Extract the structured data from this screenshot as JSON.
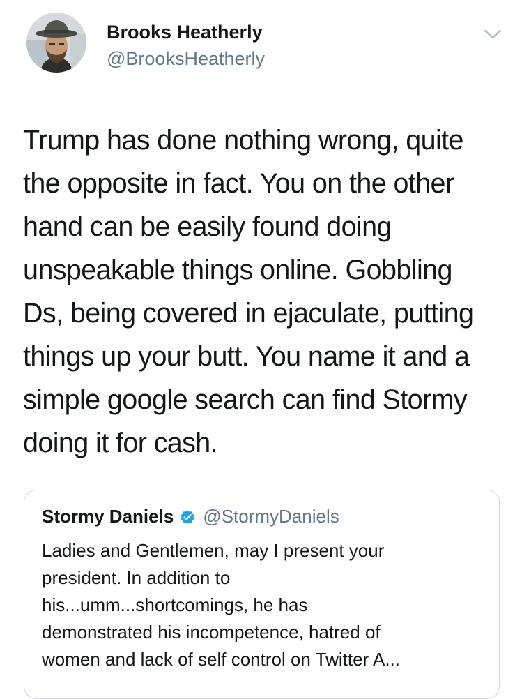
{
  "tweet": {
    "author": {
      "name": "Brooks Heatherly",
      "handle": "@BrooksHeatherly"
    },
    "text": "Trump has done nothing wrong, quite\nthe opposite in fact. You on the other\nhand can be easily found doing\nunspeakable things online. Gobbling\nDs, being covered in ejaculate, putting\nthings up your butt. You name it and a\nsimple google search can find Stormy\ndoing it for cash.",
    "quoted": {
      "name": "Stormy Daniels",
      "handle": "@StormyDaniels",
      "verified": true,
      "text": "Ladies and Gentlemen,  may I present your\npresident. In addition to\nhis...umm...shortcomings, he has\ndemonstrated his incompetence, hatred of\nwomen and lack of self control on Twitter A..."
    }
  },
  "icons": {
    "more": "chevron-down-icon",
    "verified": "verified-badge-icon"
  },
  "colors": {
    "text_primary": "#14171a",
    "text_secondary": "#657786",
    "verified_blue": "#1da1f2",
    "card_border": "#ccd6dd",
    "chevron": "#aab8c2"
  }
}
